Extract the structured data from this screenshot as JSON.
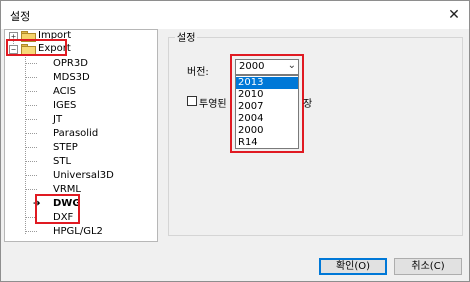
{
  "window": {
    "title": "설정",
    "close_glyph": "✕"
  },
  "tree": {
    "import": {
      "label": "Import",
      "expander": "+"
    },
    "export": {
      "label": "Export",
      "expander": "−",
      "children": [
        "OPR3D",
        "MDS3D",
        "ACIS",
        "IGES",
        "JT",
        "Parasolid",
        "STEP",
        "STL",
        "Universal3D",
        "VRML",
        "DWG",
        "DXF",
        "HPGL/GL2"
      ],
      "selected": "DWG"
    }
  },
  "panel": {
    "group_title": "설정",
    "version_label": "버전:",
    "version_value": "2000",
    "version_options": [
      "2013",
      "2010",
      "2007",
      "2004",
      "2000",
      "R14"
    ],
    "highlighted_option": "2013",
    "checkbox_label_left": "투영된",
    "checkbox_label_right": "장",
    "checkbox_checked": false
  },
  "buttons": {
    "ok": "확인(O)",
    "cancel": "취소(C)"
  },
  "colors": {
    "highlight": "#e01a22",
    "selection": "#0078d7"
  }
}
